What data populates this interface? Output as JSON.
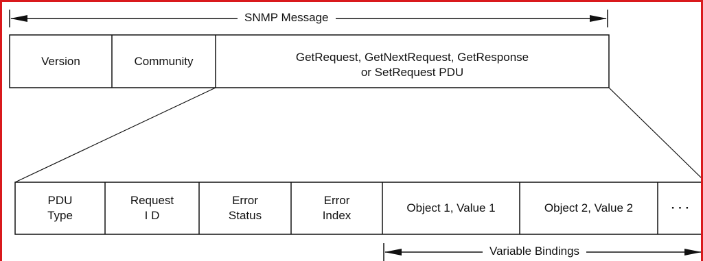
{
  "message": {
    "title": "SNMP Message",
    "fields": [
      "Version",
      "Community",
      "GetRequest, GetNextRequest, GetResponse\nor SetRequest PDU"
    ]
  },
  "pdu": {
    "fields": [
      "PDU\nType",
      "Request\nI D",
      "Error\nStatus",
      "Error\nIndex",
      "Object 1, Value 1",
      "Object 2, Value 2",
      "· · ·"
    ],
    "bindings_label": "Variable Bindings"
  },
  "colors": {
    "frame": "#d9191c",
    "line": "#111111"
  }
}
